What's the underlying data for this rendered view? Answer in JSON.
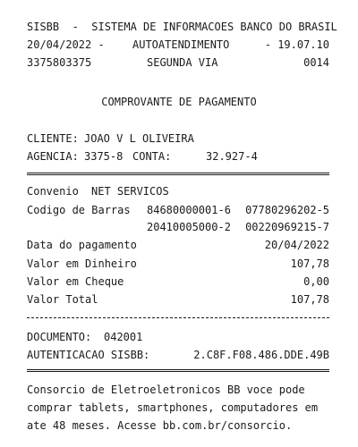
{
  "header": {
    "line1": "SISBB  -  SISTEMA DE INFORMACOES BANCO DO BRASIL",
    "date": "20/04/2022 -",
    "channel": "AUTOATENDIMENTO",
    "version": "- 19.07.10",
    "terminal": "3375803375",
    "copy": "SEGUNDA VIA",
    "seq": "0014"
  },
  "title": "COMPROVANTE DE PAGAMENTO",
  "customer": {
    "name_label": "CLIENTE:",
    "name": "JOAO V L OLIVEIRA",
    "agency_label": "AGENCIA:",
    "agency": "3375-8",
    "account_label": "CONTA:",
    "account": "32.927-4"
  },
  "details": {
    "convenio_label": "Convenio",
    "convenio": "NET SERVICOS",
    "barcode_label": "Codigo de Barras",
    "barcode_1a": "84680000001-6",
    "barcode_1b": "07780296202-5",
    "barcode_2a": "20410005000-2",
    "barcode_2b": "00220969215-7",
    "date_label": "Data do pagamento",
    "date": "20/04/2022",
    "cash_label": "Valor em Dinheiro",
    "cash": "107,78",
    "cheque_label": "Valor em Cheque",
    "cheque": "0,00",
    "total_label": "Valor Total",
    "total": "107,78"
  },
  "auth": {
    "doc_label": "DOCUMENTO:",
    "doc": "042001",
    "auth_label": "AUTENTICACAO SISBB:",
    "auth": "2.C8F.F08.486.DDE.49B"
  },
  "footer": {
    "line1": "Consorcio de Eletroeletronicos BB voce pode",
    "line2": "comprar tablets, smartphones, computadores em",
    "line3": "ate 48 meses. Acesse bb.com.br/consorcio."
  }
}
